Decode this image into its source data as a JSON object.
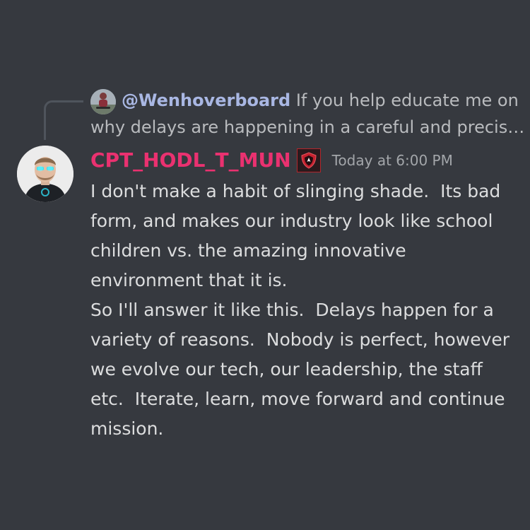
{
  "reply": {
    "username": "@Wenhoverboard",
    "preview_line1": "If you help educate me on",
    "preview_line2": "why delays are happening in a careful and precis…",
    "avatar_icon": "user-avatar-icon"
  },
  "message": {
    "author": "CPT_HODL_T_MUN",
    "author_color": "#ea3170",
    "role_icon": "shield-badge-icon",
    "timestamp": "Today at 6:00 PM",
    "avatar_icon": "user-avatar-icon",
    "paragraphs": [
      "I don't make a habit of slinging shade.  Its bad form, and makes our industry look like school children vs. the amazing innovative environment that it is.",
      "So I'll answer it like this.  Delays happen for a variety of reasons.  Nobody is perfect, however we evolve our tech, our leadership, the staff etc.  Iterate, learn, move forward and continue mission."
    ]
  },
  "colors": {
    "background": "#36393f",
    "reply_username": "#a9b7e3",
    "muted_text": "#b9bbbe",
    "body_text": "#dcddde",
    "timestamp": "#a3a6aa"
  }
}
